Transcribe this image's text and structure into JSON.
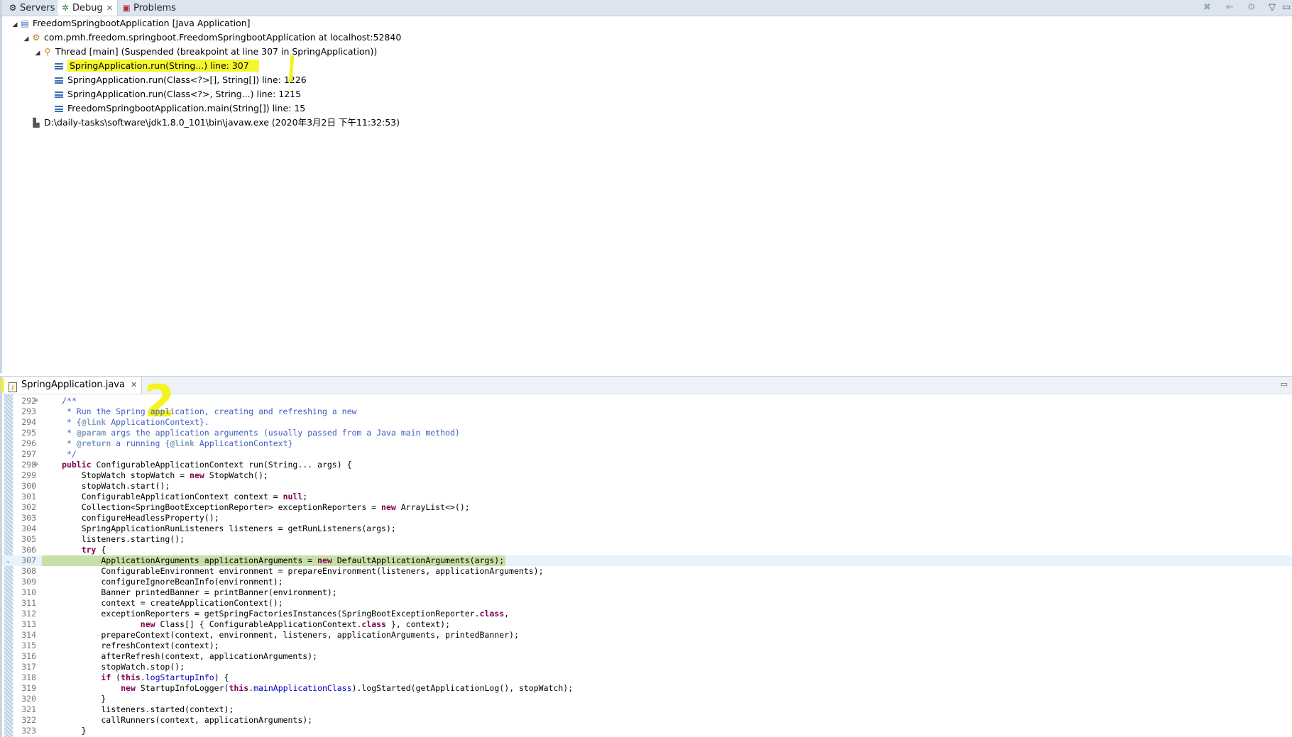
{
  "debug_view": {
    "tabs": [
      {
        "label": "Servers",
        "icon": "servers-icon"
      },
      {
        "label": "Debug",
        "icon": "debug-icon",
        "close": "✕"
      },
      {
        "label": "Problems",
        "icon": "problems-icon"
      }
    ],
    "tree": {
      "app": "FreedomSpringbootApplication [Java Application]",
      "vm": "com.pmh.freedom.springboot.FreedomSpringbootApplication at localhost:52840",
      "thread": "Thread [main] (Suspended (breakpoint at line 307 in SpringApplication))",
      "frames": [
        "SpringApplication.run(String...) line: 307",
        "SpringApplication.run(Class<?>[], String[]) line: 1226",
        "SpringApplication.run(Class<?>, String...) line: 1215",
        "FreedomSpringbootApplication.main(String[]) line: 15"
      ],
      "process": "D:\\daily-tasks\\software\\jdk1.8.0_101\\bin\\javaw.exe (2020年3月2日 下午11:32:53)"
    },
    "annotation_1": "1"
  },
  "editor": {
    "tab_label": "SpringApplication.java",
    "tab_close": "✕",
    "annotation_2": "2",
    "current_line": "307",
    "colors": {
      "highlight": "#f3f31e",
      "current_line_bg": "#c6e0a8",
      "keyword": "#7f0055",
      "comment": "#3f5fbf"
    }
  }
}
